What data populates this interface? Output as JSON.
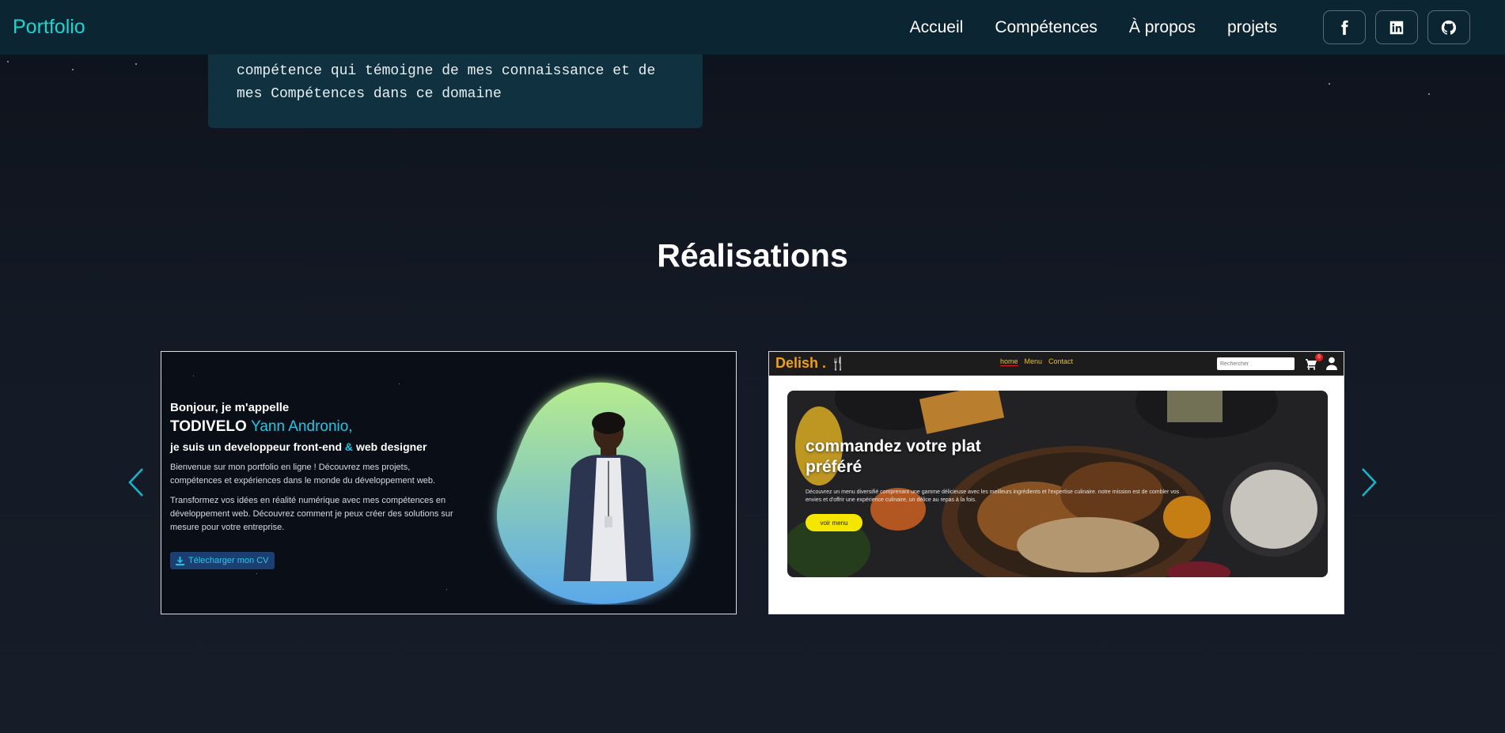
{
  "navbar": {
    "brand": "Portfolio",
    "links": [
      "Accueil",
      "Compétences",
      "À propos",
      "projets"
    ],
    "socials": [
      "facebook-icon",
      "linkedin-icon",
      "github-icon"
    ]
  },
  "skill_card": {
    "text": "compétence qui témoigne de mes connaissance et de mes Compétences dans ce domaine"
  },
  "section": {
    "title": "Réalisations"
  },
  "carousel": {
    "prev_icon": "chevron-left-icon",
    "next_icon": "chevron-right-icon",
    "slide1": {
      "hello": "Bonjour, je m'appelle",
      "name_first": "TODIVELO",
      "name_last": "Yann Andronio,",
      "role_start": "je suis un developpeur front-end",
      "role_amp": "&",
      "role_end": "web designer",
      "para1": "Bienvenue sur mon portfolio en ligne ! Découvrez mes projets, compétences et expériences dans le monde du développement web.",
      "para2": "Transformez vos idées en réalité numérique avec mes compétences en développement web. Découvrez comment je peux créer des solutions sur mesure pour votre entreprise.",
      "cv_button": "Télecharger mon CV"
    },
    "slide2": {
      "logo": "Delish .",
      "links": [
        "home",
        "Menu",
        "Contact"
      ],
      "search_placeholder": "Rechercher",
      "cart_count": "0",
      "hero_title": "commandez votre plat préféré",
      "hero_text": "Découvrez un menu diversifié comprenant une gamme délicieuse avec les meilleurs ingrédients et l'expertise culinaire. notre mission est de combler vos envies et d'offrir une expérience culinaire, un délice au repas à la fois.",
      "hero_button": "voir menu"
    }
  },
  "colors": {
    "accent": "#19d6d0",
    "navbar_bg": "#0b2533",
    "card_bg": "#0f3140",
    "delish_yellow": "#f5e600"
  }
}
